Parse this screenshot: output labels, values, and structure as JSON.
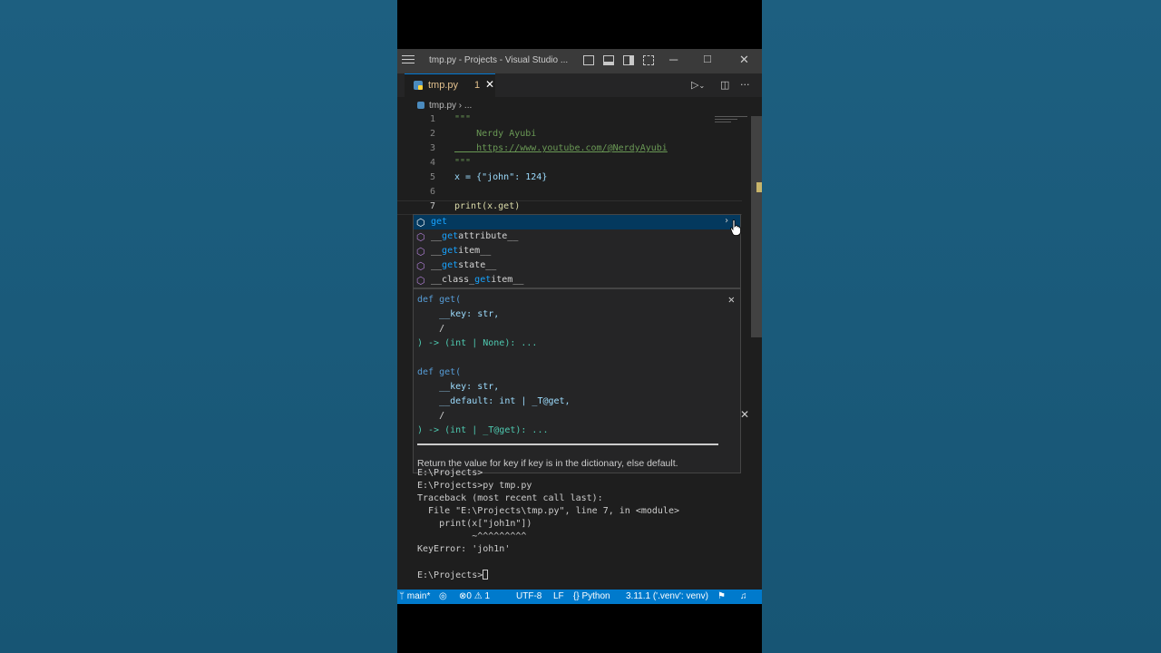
{
  "window": {
    "title": "tmp.py - Projects - Visual Studio ...",
    "controls": [
      "minimize",
      "maximize",
      "close"
    ]
  },
  "tab": {
    "name": "tmp.py",
    "problems_badge": "1"
  },
  "breadcrumb": {
    "file": "tmp.py",
    "separator": "›",
    "more": "..."
  },
  "editor": {
    "lines": [
      {
        "n": "1",
        "text": "\"\"\""
      },
      {
        "n": "2",
        "text": "    Nerdy Ayubi"
      },
      {
        "n": "3",
        "text": "    https://www.youtube.com/@NerdyAyubi"
      },
      {
        "n": "4",
        "text": "\"\"\""
      },
      {
        "n": "5",
        "text": "x = {\"john\": 124}"
      },
      {
        "n": "6",
        "text": ""
      },
      {
        "n": "7",
        "text": "print(x.get)"
      }
    ]
  },
  "suggestions": {
    "items": [
      {
        "prefix": "",
        "match": "get",
        "suffix": "",
        "selected": true
      },
      {
        "prefix": "__",
        "match": "get",
        "suffix": "attribute__"
      },
      {
        "prefix": "__",
        "match": "get",
        "suffix": "item__"
      },
      {
        "prefix": "__",
        "match": "get",
        "suffix": "state__"
      },
      {
        "prefix": "__class_",
        "match": "get",
        "suffix": "item__"
      }
    ]
  },
  "details": {
    "sig1": [
      "def get(",
      "    __key: str,",
      "    /",
      ") -> (int | None): ..."
    ],
    "sig2": [
      "def get(",
      "    __key: str,",
      "    __default: int | _T@get,",
      "    /",
      ") -> (int | _T@get): ..."
    ],
    "doc": "Return the value for key if key is in the dictionary, else default."
  },
  "terminal": {
    "lines": [
      "E:\\Projects>",
      "E:\\Projects>py tmp.py",
      "Traceback (most recent call last):",
      "  File \"E:\\Projects\\tmp.py\", line 7, in <module>",
      "    print(x[\"joh1n\"])",
      "          ~^^^^^^^^^",
      "KeyError: 'joh1n'",
      "",
      "E:\\Projects>"
    ]
  },
  "statusbar": {
    "branch": "main*",
    "errors": "0",
    "warnings": "1",
    "encoding": "UTF-8",
    "eol": "LF",
    "language": "Python",
    "interpreter": "3.11.1 ('.venv': venv)"
  },
  "colors": {
    "accent": "#007acc",
    "editor_bg": "#1e1e1e",
    "background": "#1a5a7a"
  }
}
